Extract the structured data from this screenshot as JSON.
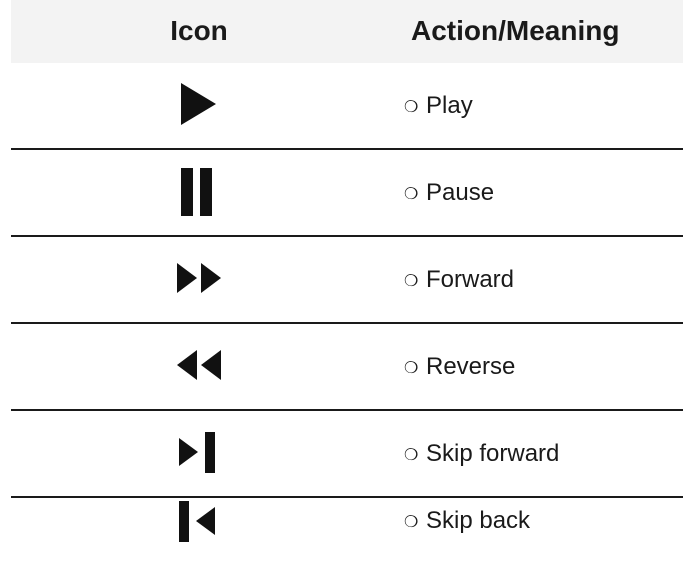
{
  "header": {
    "icon_col": "Icon",
    "action_col": "Action/Meaning"
  },
  "bullet": "❍",
  "rows": [
    {
      "label": "Play",
      "icon": "play-icon"
    },
    {
      "label": "Pause",
      "icon": "pause-icon"
    },
    {
      "label": "Forward",
      "icon": "fast-forward-icon"
    },
    {
      "label": "Reverse",
      "icon": "rewind-icon"
    },
    {
      "label": "Skip forward",
      "icon": "skip-forward-icon"
    },
    {
      "label": "Skip back",
      "icon": "skip-back-icon"
    }
  ],
  "colors": {
    "header_bg": "#f3f3f3",
    "icon": "#111111",
    "divider": "#1a1a1a"
  }
}
